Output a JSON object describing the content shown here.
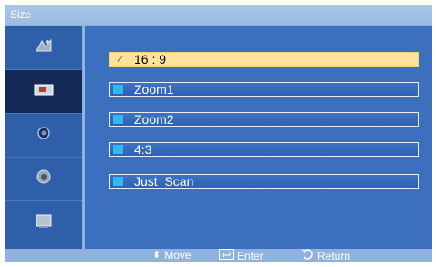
{
  "title": "Size",
  "sidebar": {
    "items": [
      {
        "name": "picture-icon"
      },
      {
        "name": "size-icon",
        "active": true
      },
      {
        "name": "sound-icon"
      },
      {
        "name": "setup-icon"
      },
      {
        "name": "input-icon"
      }
    ]
  },
  "options": [
    {
      "label": "16 : 9",
      "selected": true
    },
    {
      "label": "Zoom1"
    },
    {
      "label": "Zoom2"
    },
    {
      "label": "4:3"
    },
    {
      "label": "Just  Scan"
    }
  ],
  "footer": {
    "move": "Move",
    "enter": "Enter",
    "return": "Return"
  },
  "colors": {
    "panel_bg": "#8fb2df",
    "sidebar_bg": "#2f5fa8",
    "active_bg": "#142a56",
    "content_bg": "#3c70be",
    "selected_bg": "#ffe39a",
    "marker": "#2dbaf2"
  }
}
